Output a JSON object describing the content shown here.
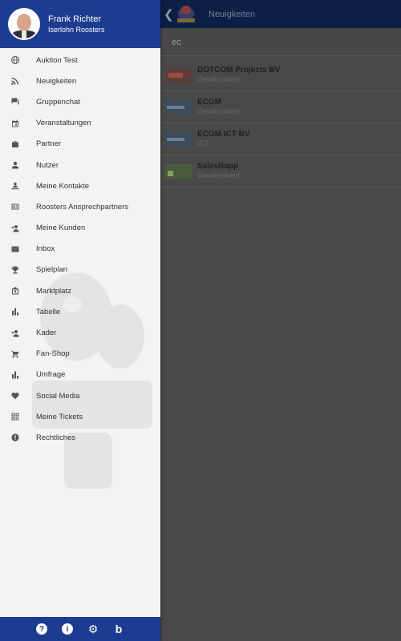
{
  "app": {
    "header_title": "Neuigkeiten",
    "search_value": "ec"
  },
  "user": {
    "name": "Frank Richter",
    "club": "Iserlohn Roosters"
  },
  "menu": [
    {
      "label": "Auktion Test",
      "icon": "globe-icon"
    },
    {
      "label": "Neuigkeiten",
      "icon": "rss-icon"
    },
    {
      "label": "Gruppenchat",
      "icon": "chat-icon"
    },
    {
      "label": "Veranstaltungen",
      "icon": "calendar-icon"
    },
    {
      "label": "Partner",
      "icon": "briefcase-icon"
    },
    {
      "label": "Nutzer",
      "icon": "person-icon"
    },
    {
      "label": "Meine Kontakte",
      "icon": "contacts-icon"
    },
    {
      "label": "Roosters Ansprechpartners",
      "icon": "contact-card-icon"
    },
    {
      "label": "Meine Kunden",
      "icon": "person-add-icon"
    },
    {
      "label": "Inbox",
      "icon": "mail-icon"
    },
    {
      "label": "Spielplan",
      "icon": "trophy-icon"
    },
    {
      "label": "Marktplatz",
      "icon": "marketplace-icon"
    },
    {
      "label": "Tabelle",
      "icon": "bar-chart-icon"
    },
    {
      "label": "Kader",
      "icon": "person-add-icon"
    },
    {
      "label": "Fan-Shop",
      "icon": "cart-icon"
    },
    {
      "label": "Umfrage",
      "icon": "bar-chart-icon"
    },
    {
      "label": "Social Media",
      "icon": "heart-icon"
    },
    {
      "label": "Meine Tickets",
      "icon": "qr-code-icon"
    },
    {
      "label": "Rechtliches",
      "icon": "info-icon"
    }
  ],
  "results": [
    {
      "name": "DOTCOM Projects BV",
      "category": "Development"
    },
    {
      "name": "ECOM",
      "category": "Development"
    },
    {
      "name": "ECOM ICT BV",
      "category": "ICT"
    },
    {
      "name": "SalesRapp",
      "category": "Development"
    }
  ],
  "footer": {
    "help": "?",
    "info": "i",
    "settings": "⚙",
    "brand": "b"
  }
}
